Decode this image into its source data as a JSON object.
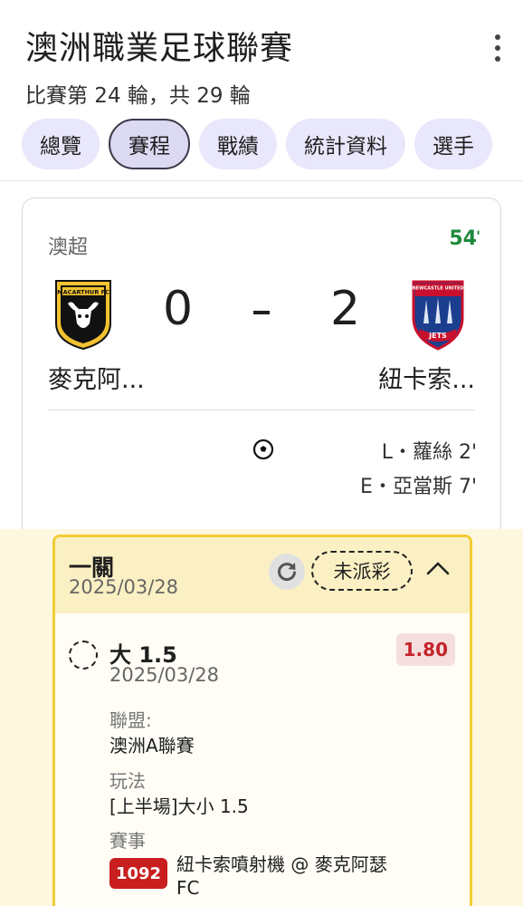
{
  "header": {
    "title": "澳洲職業足球聯賽",
    "subtitle": "比賽第 24 輪，共 29 輪",
    "menu_icon": "more-vert-icon"
  },
  "tabs": [
    {
      "label": "總覽",
      "active": false
    },
    {
      "label": "賽程",
      "active": true
    },
    {
      "label": "戰績",
      "active": false
    },
    {
      "label": "統計資料",
      "active": false
    },
    {
      "label": "選手",
      "active": false
    }
  ],
  "match": {
    "league": "澳超",
    "minute": "54",
    "minute_mark": "'",
    "home": {
      "name": "麥克阿...",
      "score": "0",
      "crest_text": "MACARTHUR FC"
    },
    "away": {
      "name": "紐卡索...",
      "score": "2",
      "crest_text_top": "NEWCASTLE UNITED",
      "crest_text_bottom": "JETS"
    },
    "scorers": [
      {
        "text": "L・蘿絲 2'"
      },
      {
        "text": "E・亞當斯 7'"
      }
    ]
  },
  "slip": {
    "title": "一關",
    "date": "2025/03/28",
    "status": "未派彩",
    "pick": {
      "name": "大 1.5",
      "date": "2025/03/28",
      "odds": "1.80"
    },
    "league_label": "聯盟:",
    "league_value": "澳洲A聯賽",
    "market_label": "玩法",
    "market_value": "[上半場]大小 1.5",
    "event_label": "賽事",
    "event_badge": "1092",
    "event_text": "紐卡索噴射機 @ 麥克阿瑟FC"
  },
  "colors": {
    "tab_bg": "#e9e7fb",
    "live_green": "#1e8a3a",
    "slip_border": "#f2cc35",
    "odds_red": "#c3232b",
    "badge_red": "#c81e1e"
  }
}
